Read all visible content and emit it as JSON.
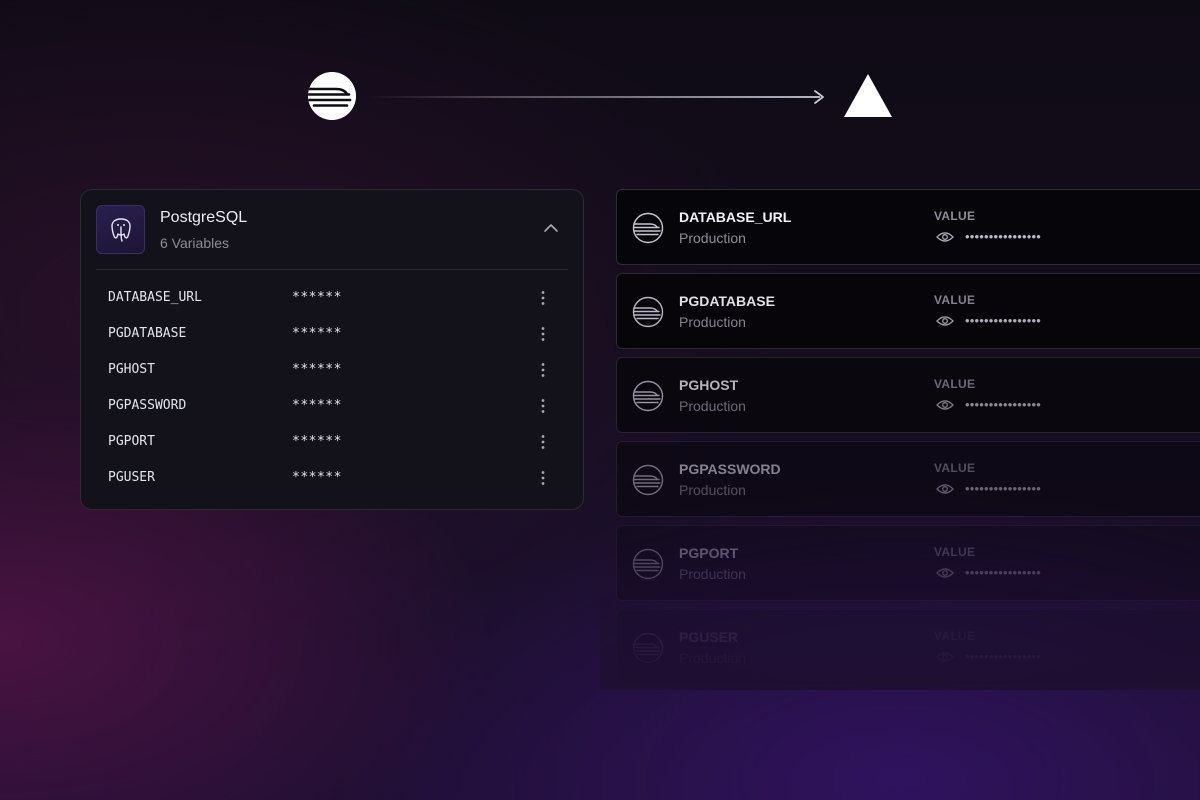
{
  "header": {
    "source_icon": "railway-icon",
    "connector_icon": "arrow-right-icon",
    "target_icon": "vercel-icon"
  },
  "pg_panel": {
    "icon": "postgresql-icon",
    "title": "PostgreSQL",
    "subtitle": "6 Variables",
    "collapse_icon": "chevron-up-icon",
    "variables": [
      {
        "name": "DATABASE_URL",
        "value": "******"
      },
      {
        "name": "PGDATABASE",
        "value": "******"
      },
      {
        "name": "PGHOST",
        "value": "******"
      },
      {
        "name": "PGPASSWORD",
        "value": "******"
      },
      {
        "name": "PGPORT",
        "value": "******"
      },
      {
        "name": "PGUSER",
        "value": "******"
      }
    ]
  },
  "env_vars": {
    "value_label": "VALUE",
    "items": [
      {
        "name": "DATABASE_URL",
        "target": "Production",
        "value": "••••••••••••••••",
        "opacity": 1.0
      },
      {
        "name": "PGDATABASE",
        "target": "Production",
        "value": "••••••••••••••••",
        "opacity": 0.92
      },
      {
        "name": "PGHOST",
        "target": "Production",
        "value": "••••••••••••••••",
        "opacity": 0.72
      },
      {
        "name": "PGPASSWORD",
        "target": "Production",
        "value": "••••••••••••••••",
        "opacity": 0.5
      },
      {
        "name": "PGPORT",
        "target": "Production",
        "value": "••••••••••••••••",
        "opacity": 0.3
      },
      {
        "name": "PGUSER",
        "target": "Production",
        "value": "••••••••••••••••",
        "opacity": 0.14
      }
    ]
  },
  "colors": {
    "background": "#140d1c",
    "panel": "#13121a",
    "card": "#060509",
    "border": "#2c2b36",
    "text_primary": "#f2f2f6",
    "text_secondary": "#8e8d99",
    "accent_purple": "#2a1f4f"
  }
}
